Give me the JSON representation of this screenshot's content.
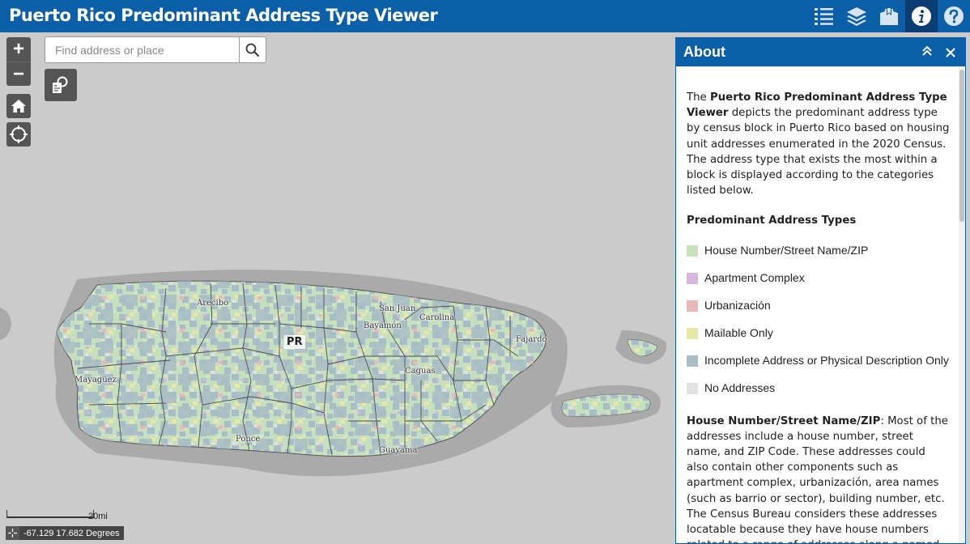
{
  "header": {
    "title": "Puerto Rico Predominant Address Type Viewer",
    "tools": [
      {
        "icon": "legend-icon"
      },
      {
        "icon": "layers-icon"
      },
      {
        "icon": "bookmark-icon"
      },
      {
        "icon": "info-icon",
        "active": true
      },
      {
        "icon": "help-icon"
      }
    ]
  },
  "map": {
    "search_placeholder": "Find address or place",
    "zoom_in": "+",
    "zoom_out": "−",
    "scale_label": "20mi",
    "coordinates": "-67.129 17.682 Degrees",
    "island_label": "PR",
    "places": [
      {
        "name": "Arecibo"
      },
      {
        "name": "San Juan"
      },
      {
        "name": "Carolina"
      },
      {
        "name": "Bayamón"
      },
      {
        "name": "Fajardo"
      },
      {
        "name": "Mayagüez"
      },
      {
        "name": "Caguas"
      },
      {
        "name": "Ponce"
      },
      {
        "name": "Guayama"
      }
    ]
  },
  "about": {
    "title": "About",
    "intro_prefix": "The ",
    "intro_bold": "Puerto Rico Predominant Address Type Viewer",
    "intro_rest": " depicts the predominant address type by census block in Puerto Rico based on housing unit addresses enumerated in the 2020 Census. The address type that exists the most within a block is displayed according to the categories listed below.",
    "legend_heading": "Predominant Address Types",
    "legend": [
      {
        "label": "House Number/Street Name/ZIP",
        "color": "#c8e2bd"
      },
      {
        "label": "Apartment Complex",
        "color": "#d7b6e0"
      },
      {
        "label": "Urbanización",
        "color": "#e9b7b7"
      },
      {
        "label": "Mailable Only",
        "color": "#e7e8a6"
      },
      {
        "label": "Incomplete Address or Physical Description Only",
        "color": "#a9bdc6"
      },
      {
        "label": "No Addresses",
        "color": "#e2e2e2"
      }
    ],
    "section_bold": "House Number/Street Name/ZIP",
    "section_text": ": Most of the addresses include a house number, street name, and ZIP Code. These addresses could also contain other components such as apartment complex, urbanización, area names (such as barrio or sector), building number, etc. The Census Bureau considers these addresses locatable because they have house numbers related to a range of addresses along a named street."
  }
}
